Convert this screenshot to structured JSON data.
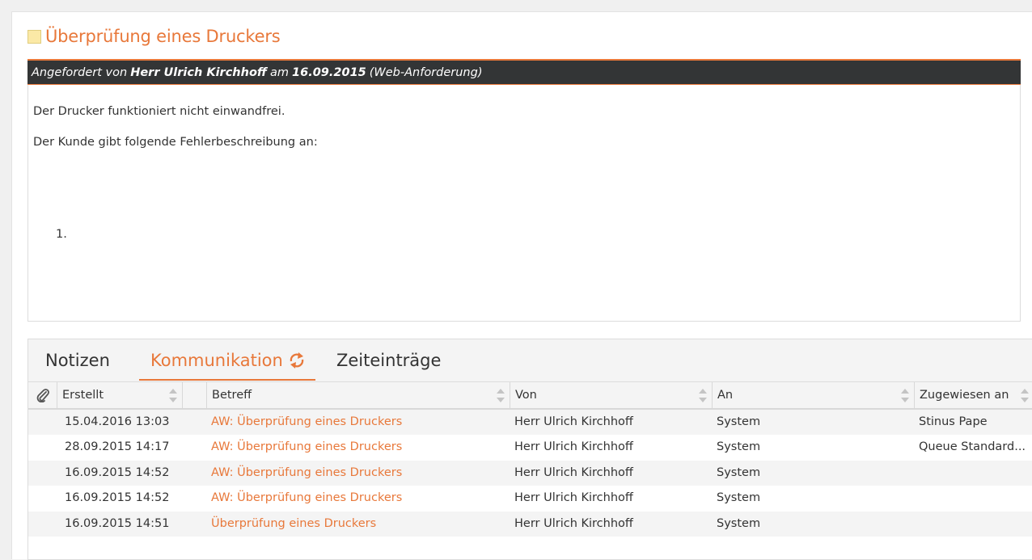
{
  "ticket": {
    "title": "Überprüfung eines Druckers",
    "request": {
      "prefix": "Angefordert von",
      "requester": "Herr Ulrich Kirchhoff",
      "on_word": "am",
      "date": "16.09.2015",
      "source": "(Web-Anforderung)"
    },
    "description": {
      "line1": "Der Drucker funktioniert nicht einwandfrei.",
      "line2": "Der Kunde gibt folgende Fehlerbeschreibung an:",
      "list_marker": "1."
    }
  },
  "tabs": [
    {
      "label": "Notizen",
      "active": false
    },
    {
      "label": "Kommunikation",
      "active": true
    },
    {
      "label": "Zeiteinträge",
      "active": false
    }
  ],
  "table": {
    "columns": [
      "Erstellt",
      "Betreff",
      "Von",
      "An",
      "Zugewiesen an"
    ],
    "rows": [
      {
        "created": "15.04.2016 13:03",
        "subject": "AW: Überprüfung eines Druckers",
        "from": "Herr Ulrich Kirchhoff",
        "to": "System",
        "assigned": "Stinus Pape"
      },
      {
        "created": "28.09.2015 14:17",
        "subject": "AW: Überprüfung eines Druckers",
        "from": "Herr Ulrich Kirchhoff",
        "to": "System",
        "assigned": "Queue Standard..."
      },
      {
        "created": "16.09.2015 14:52",
        "subject": "AW: Überprüfung eines Druckers",
        "from": "Herr Ulrich Kirchhoff",
        "to": "System",
        "assigned": ""
      },
      {
        "created": "16.09.2015 14:52",
        "subject": "AW: Überprüfung eines Druckers",
        "from": "Herr Ulrich Kirchhoff",
        "to": "System",
        "assigned": ""
      },
      {
        "created": "16.09.2015 14:51",
        "subject": "Überprüfung eines Druckers",
        "from": "Herr Ulrich Kirchhoff",
        "to": "System",
        "assigned": ""
      }
    ]
  },
  "colors": {
    "accent": "#e8783a",
    "header_bar": "#333536",
    "note_icon": "#fbe9a6"
  },
  "icons": {
    "title": "note-icon",
    "sync": "sync-icon",
    "attachment": "paperclip-icon"
  }
}
